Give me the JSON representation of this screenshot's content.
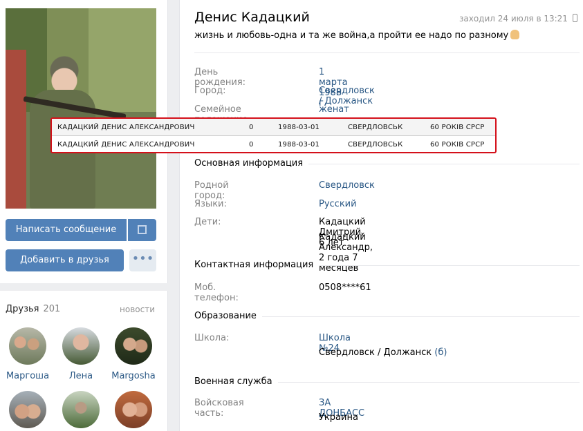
{
  "profile": {
    "name": "Денис Кадацкий",
    "last_seen": "заходил 24 июля в 13:21",
    "status": "жизнь и любовь-одна и та же война,а пройти ее надо по разному"
  },
  "actions": {
    "message": "Написать сообщение",
    "add_friend": "Добавить в друзья",
    "more": "•••"
  },
  "friends": {
    "title": "Друзья",
    "count": "201",
    "news_link": "новости",
    "items": [
      {
        "name": "Маргоша"
      },
      {
        "name": "Лена"
      },
      {
        "name": "Margosha"
      },
      {
        "name": ""
      },
      {
        "name": ""
      },
      {
        "name": ""
      }
    ]
  },
  "info": {
    "birthday_label": "День рождения:",
    "birthday": "1 марта 1988 г.",
    "city_label": "Город:",
    "city": "Свердловск / Должанск",
    "family_label": "Семейное положение:",
    "family": "женат"
  },
  "overlay_table": {
    "rows": [
      {
        "name": "КАДАЦКИЙ ДЕНИС АЛЕКСАНДРОВИЧ",
        "num": "0",
        "date": "1988-03-01",
        "city": "СВЕРДЛОВСЬК",
        "region": "60 РОКІВ СРСР"
      },
      {
        "name": "КАДАЦКИЙ ДЕНИС АЛЕКСАНДРОВИЧ",
        "num": "0",
        "date": "1988-03-01",
        "city": "СВЕРДЛОВСЬК",
        "region": "60 РОКІВ СРСР"
      }
    ],
    "border_color": "#d4101a"
  },
  "basic": {
    "section": "Основная информация",
    "hometown_label": "Родной город:",
    "hometown": "Свердловск",
    "languages_label": "Языки:",
    "languages": "Русский",
    "children_label": "Дети:",
    "child1": "Кадацкий Дмитрий, 6 лет",
    "child2": "Кадацкий Александр, 2 года 7 месяцев"
  },
  "contacts": {
    "section": "Контактная информация",
    "phone_label": "Моб. телефон:",
    "phone": "0508****61"
  },
  "education": {
    "section": "Образование",
    "school_label": "Школа:",
    "school": "Школа №24",
    "school_city": "Свердловск / Должанск",
    "school_class": "(б)"
  },
  "military": {
    "section": "Военная служба",
    "unit_label": "Войсковая часть:",
    "unit": "ЗА ДОНБАСС",
    "country": "Украина"
  },
  "colors": {
    "accent": "#5181b8",
    "link": "#2a5885",
    "label": "#828282"
  }
}
